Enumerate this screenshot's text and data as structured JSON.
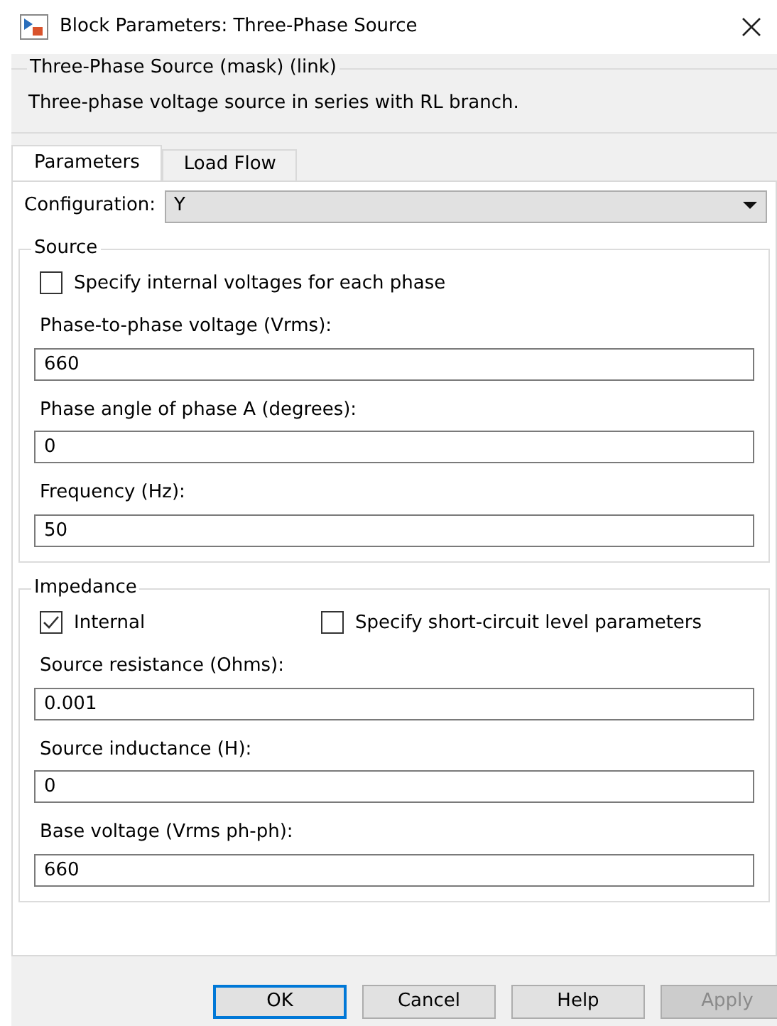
{
  "window": {
    "title": "Block Parameters: Three-Phase Source"
  },
  "mask": {
    "title": "Three-Phase Source (mask) (link)",
    "description": "Three-phase voltage source in series with RL branch."
  },
  "tabs": [
    {
      "label": "Parameters",
      "selected": true
    },
    {
      "label": "Load Flow",
      "selected": false
    }
  ],
  "configuration": {
    "label": "Configuration:",
    "value": "Y"
  },
  "sections": [
    {
      "title": "Source",
      "checkboxes": [
        {
          "label": "Specify internal voltages for each phase",
          "checked": false
        }
      ],
      "fields": [
        {
          "label": "Phase-to-phase voltage (Vrms):",
          "value": "660"
        },
        {
          "label": "Phase angle of phase A (degrees):",
          "value": "0"
        },
        {
          "label": "Frequency (Hz):",
          "value": "50"
        }
      ]
    },
    {
      "title": "Impedance",
      "checkboxes": [
        {
          "label": "Internal",
          "checked": true
        },
        {
          "label": "Specify short-circuit level parameters",
          "checked": false
        }
      ],
      "fields": [
        {
          "label": "Source resistance (Ohms):",
          "value": "0.001"
        },
        {
          "label": "Source inductance (H):",
          "value": "0"
        },
        {
          "label": "Base voltage (Vrms ph-ph):",
          "value": "660"
        }
      ]
    }
  ],
  "buttons": [
    {
      "label": "OK",
      "disabled": false,
      "default": true
    },
    {
      "label": "Cancel",
      "disabled": false,
      "default": false
    },
    {
      "label": "Help",
      "disabled": false,
      "default": false
    },
    {
      "label": "Apply",
      "disabled": true,
      "default": false
    }
  ]
}
